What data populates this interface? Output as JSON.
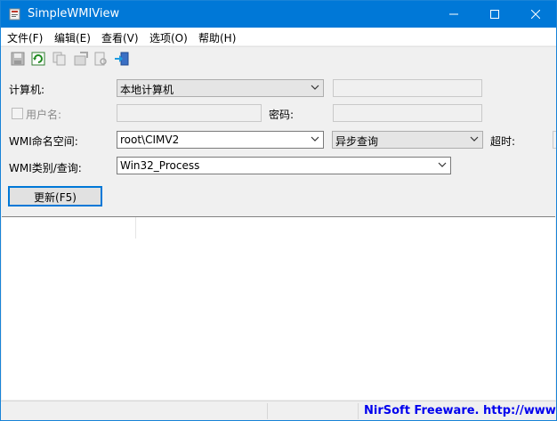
{
  "window": {
    "title": "SimpleWMIView",
    "controls": {
      "minimize": "minimize",
      "maximize": "maximize",
      "close": "close"
    }
  },
  "menu": [
    "文件(F)",
    "编辑(E)",
    "查看(V)",
    "选项(O)",
    "帮助(H)"
  ],
  "toolbar": {
    "icons": [
      "save-icon",
      "refresh-icon",
      "copy-icon",
      "properties-icon",
      "report-icon",
      "exit-icon"
    ]
  },
  "form": {
    "computer_label": "计算机:",
    "computer_value": "本地计算机",
    "username_label": "用户名:",
    "password_label": "密码:",
    "namespace_label": "WMI命名空间:",
    "namespace_value": "root\\CIMV2",
    "query_mode_value": "异步查询",
    "timeout_label": "超时:",
    "class_label": "WMI类别/查询:",
    "class_value": "Win32_Process",
    "refresh_button": "更新(F5)"
  },
  "statusbar": {
    "link_text": "NirSoft Freeware.  http://www.nirs"
  },
  "colors": {
    "titlebar": "#0078d7",
    "link": "#0000ee",
    "button_focus": "#0078d7"
  }
}
